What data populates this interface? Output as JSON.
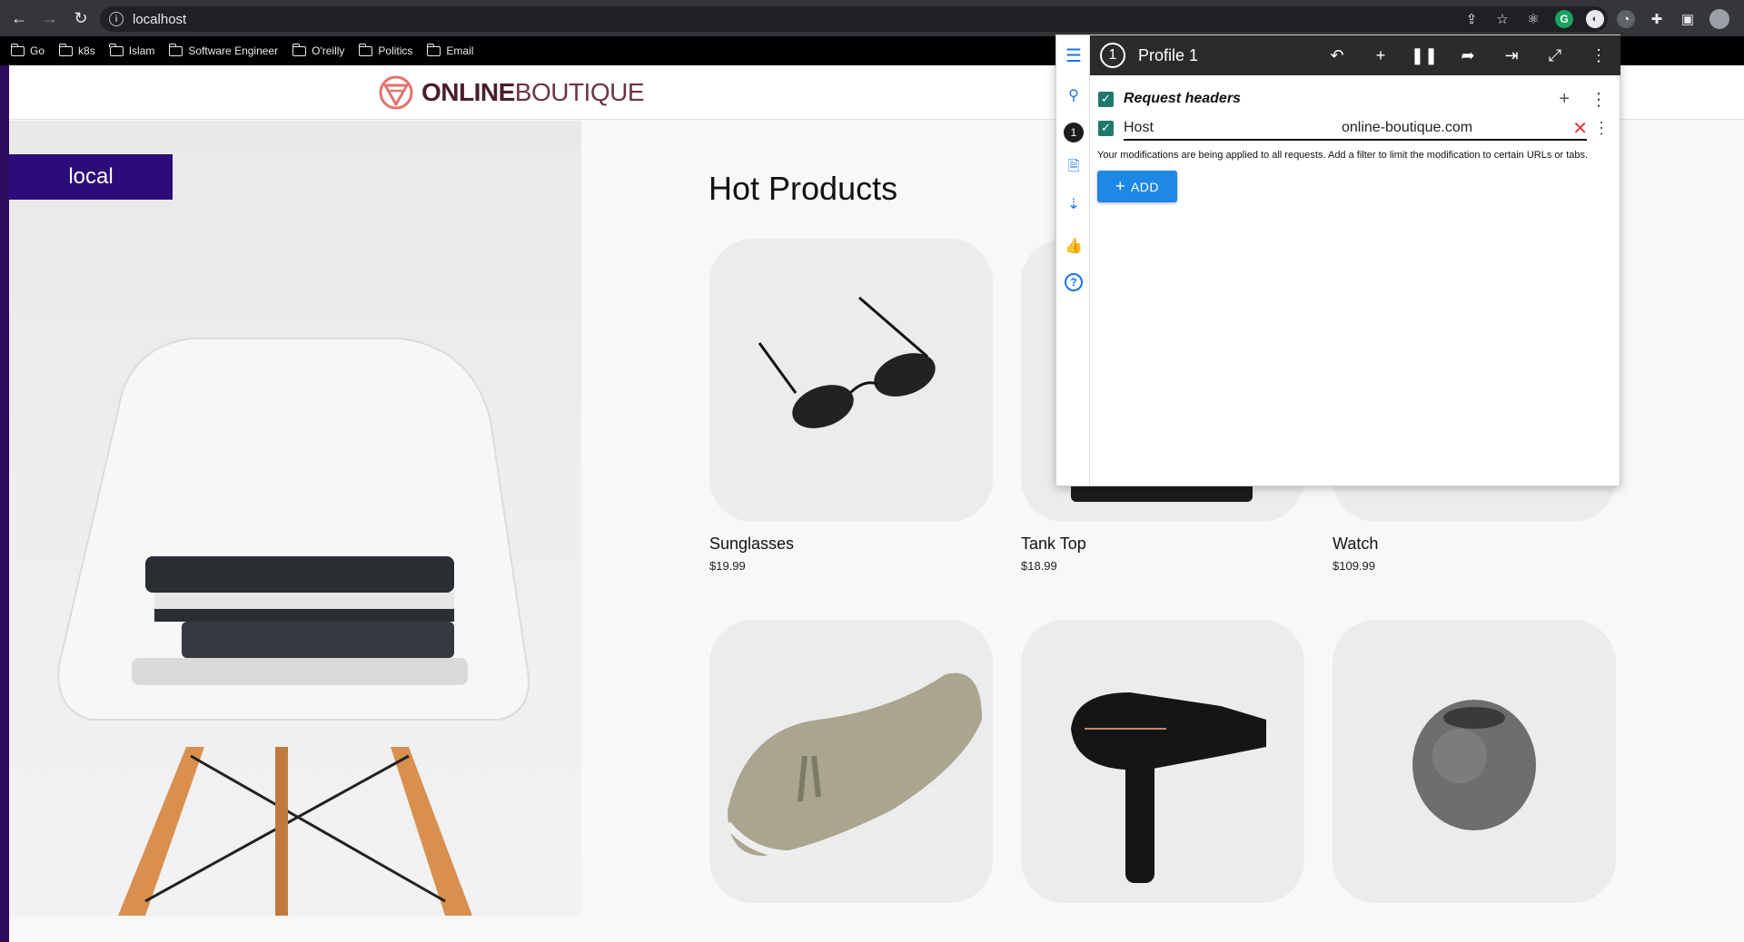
{
  "browser": {
    "url": "localhost",
    "bookmarks": [
      "Go",
      "k8s",
      "Islam",
      "Software Engineer",
      "O'reilly",
      "Politics",
      "Email"
    ]
  },
  "site": {
    "logo_bold": "ONLINE",
    "logo_light": "BOUTIQUE",
    "env_badge": "local",
    "section_title": "Hot Products",
    "products": [
      {
        "name": "Sunglasses",
        "price": "$19.99"
      },
      {
        "name": "Tank Top",
        "price": "$18.99"
      },
      {
        "name": "Watch",
        "price": "$109.99"
      },
      {
        "name": "",
        "price": ""
      },
      {
        "name": "",
        "price": ""
      },
      {
        "name": "",
        "price": ""
      }
    ]
  },
  "extension": {
    "profile_number": "1",
    "profile_name": "Profile 1",
    "sidebar_badge": "1",
    "section_title": "Request headers",
    "header_name": "Host",
    "header_value": "online-boutique.com",
    "note": "Your modifications are being applied to all requests. Add a filter to limit the modification to certain URLs or tabs.",
    "add_label": "ADD"
  },
  "colors": {
    "env_badge": "#2d0b7a",
    "checkbox": "#1f7a6b",
    "add_button": "#1e88e5",
    "remove_icon": "#e53935"
  }
}
